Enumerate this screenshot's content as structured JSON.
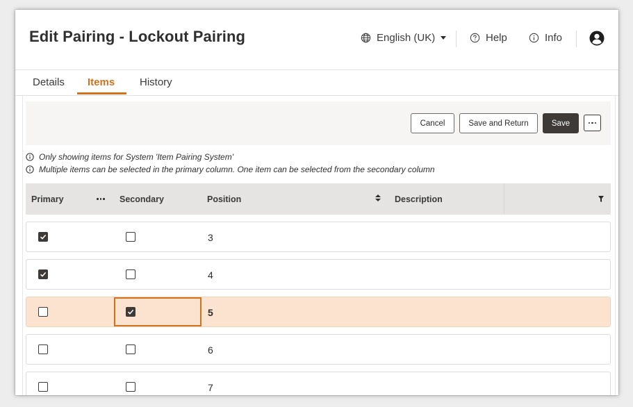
{
  "header": {
    "title": "Edit Pairing - Lockout Pairing",
    "language": "English (UK)",
    "help": "Help",
    "info": "Info",
    "icons": [
      "globe-icon",
      "help-circle-icon",
      "info-circle-icon",
      "user-avatar-icon"
    ]
  },
  "tabs": [
    {
      "label": "Details",
      "active": false
    },
    {
      "label": "Items",
      "active": true
    },
    {
      "label": "History",
      "active": false
    }
  ],
  "toolbar": {
    "cancel": "Cancel",
    "save_and_return": "Save and Return",
    "save": "Save"
  },
  "notes": [
    "Only showing items for System 'Item Pairing System'",
    "Multiple items can be selected in the primary column. One item can be selected from the secondary column"
  ],
  "grid": {
    "columns": {
      "primary": "Primary",
      "secondary": "Secondary",
      "position": "Position",
      "description": "Description"
    },
    "rows": [
      {
        "primary": true,
        "secondary": false,
        "position": "3",
        "description": "",
        "selected": false
      },
      {
        "primary": true,
        "secondary": false,
        "position": "4",
        "description": "",
        "selected": false
      },
      {
        "primary": false,
        "secondary": true,
        "position": "5",
        "description": "",
        "selected": true
      },
      {
        "primary": false,
        "secondary": false,
        "position": "6",
        "description": "",
        "selected": false
      },
      {
        "primary": false,
        "secondary": false,
        "position": "7",
        "description": "",
        "selected": false
      }
    ]
  },
  "colors": {
    "accent": "#d1721e",
    "selected_row": "#fbe3cf",
    "primary_button": "#3d3a38",
    "toolbar_bg": "#f6f5f4",
    "grid_header_bg": "#e6e4e2"
  }
}
